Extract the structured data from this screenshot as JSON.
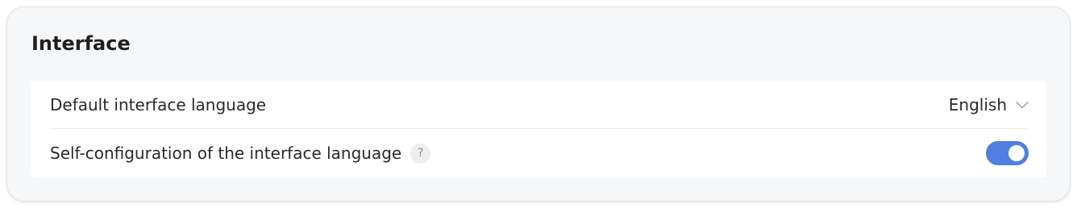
{
  "section": {
    "title": "Interface"
  },
  "settings": {
    "language": {
      "label": "Default interface language",
      "value": "English"
    },
    "self_config": {
      "label": "Self-configuration of the interface language",
      "help_glyph": "?",
      "enabled": true
    }
  },
  "colors": {
    "accent": "#4f7fdf",
    "card_background": "#f6f7f8"
  },
  "icons": {
    "dropdown": "chevron-down-icon",
    "help": "help-icon"
  }
}
